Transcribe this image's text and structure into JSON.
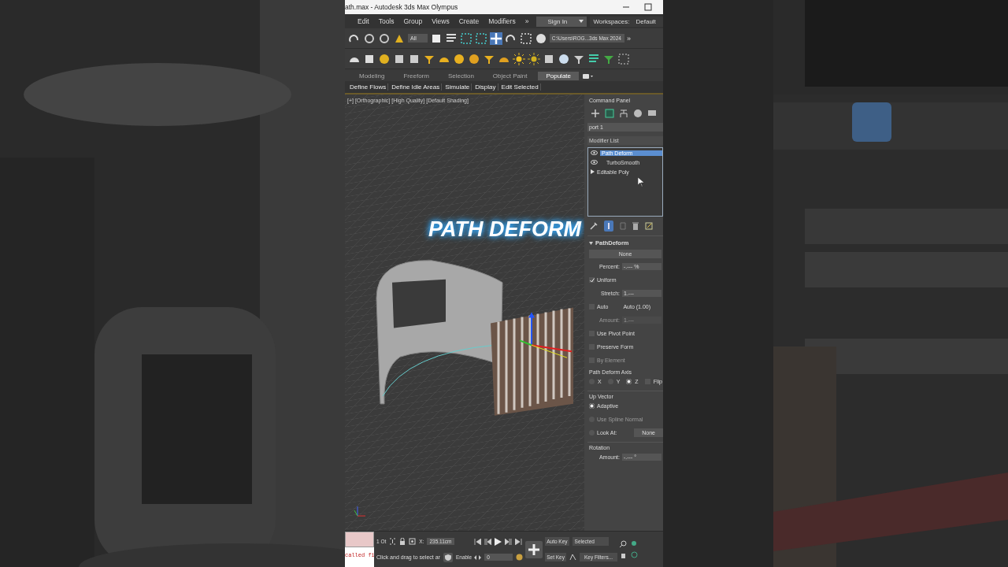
{
  "window": {
    "title": "ath.max - Autodesk 3ds Max Olympus"
  },
  "menu": [
    "Edit",
    "Tools",
    "Group",
    "Views",
    "Create",
    "Modifiers",
    "»"
  ],
  "sign_in": "Sign In",
  "workspaces": {
    "label": "Workspaces:",
    "value": "Default"
  },
  "toolbar": {
    "selection_filter": "All",
    "project_path": "C:\\Users\\ROG...3ds Max 2024",
    "more": "»"
  },
  "ribbon": {
    "tabs": [
      {
        "label": "Modeling",
        "selected": false
      },
      {
        "label": "Freeform",
        "selected": false
      },
      {
        "label": "Selection",
        "selected": false
      },
      {
        "label": "Object Paint",
        "selected": false
      },
      {
        "label": "Populate",
        "selected": true
      }
    ],
    "buttons": [
      "Define Flows",
      "Define Idle Areas",
      "Simulate",
      "Display",
      "Edit Selected"
    ]
  },
  "viewport": {
    "label": "[+] [Orthographic] [High Quality] [Default Shading]",
    "overlay_title": "PATH DEFORM"
  },
  "command_panel": {
    "title": "Command Panel",
    "object_name": "port 1",
    "modifier_list": "Modifier List",
    "stack": [
      {
        "label": "Path Deform",
        "kind": "eye",
        "selected": true
      },
      {
        "label": "TurboSmooth",
        "kind": "eye",
        "selected": false
      },
      {
        "label": "Editable Poly",
        "kind": "expand",
        "selected": false
      }
    ],
    "rollout": {
      "title": "PathDeform",
      "pick_button": "None",
      "rows": [
        {
          "kind": "spinner",
          "label": "Percent:",
          "value": "-.--- %",
          "disabled": false
        },
        {
          "kind": "checkbox",
          "label": "Uniform",
          "checked": true,
          "disabled": false
        },
        {
          "kind": "spinner",
          "label": "Stretch:",
          "value": "1.---",
          "disabled": false
        },
        {
          "kind": "checkbox",
          "label": "Auto",
          "checked": false,
          "disabled": false,
          "note": "Auto (1.00)"
        },
        {
          "kind": "spinner",
          "label": "Amount:",
          "value": "1.---",
          "disabled": true
        },
        {
          "kind": "checkbox",
          "label": "Use Pivot Point",
          "checked": false,
          "disabled": false
        },
        {
          "kind": "checkbox",
          "label": "Preserve Form",
          "checked": false,
          "disabled": false
        },
        {
          "kind": "checkbox",
          "label": "By Element",
          "checked": false,
          "disabled": true
        }
      ]
    },
    "axis_group": {
      "title": "Path Deform Axis",
      "axes": [
        {
          "label": "X",
          "selected": false
        },
        {
          "label": "Y",
          "selected": false
        },
        {
          "label": "Z",
          "selected": true
        }
      ],
      "flip": {
        "label": "Flip",
        "checked": false
      }
    },
    "up_vector": {
      "title": "Up Vector",
      "options": [
        {
          "label": "Adaptive",
          "selected": true,
          "disabled": false
        },
        {
          "label": "Use Spline Normal",
          "selected": false,
          "disabled": true
        },
        {
          "label": "Look At:",
          "selected": false,
          "disabled": false,
          "button": "None"
        }
      ]
    },
    "rotation": {
      "title": "Rotation",
      "label": "Amount:",
      "value": "-.--- °"
    }
  },
  "status_bar": {
    "listener": "called fi",
    "selected_count": "1 Ot",
    "x_label": "X:",
    "x_value": "235.11cm",
    "prompt": "Click and drag to select ar",
    "enable": "Enable",
    "frame": "0",
    "auto_key": "Auto Key",
    "key_set": "Selected",
    "set_key": "Set Key",
    "key_filters": "Key Filters..."
  }
}
